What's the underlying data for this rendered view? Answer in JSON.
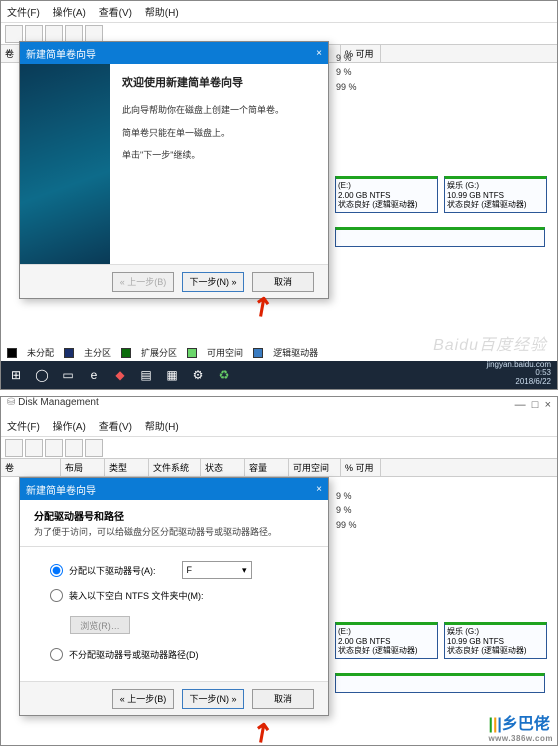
{
  "menu": {
    "file": "文件(F)",
    "action": "操作(A)",
    "view": "查看(V)",
    "help": "帮助(H)"
  },
  "app_title": "Disk Management",
  "win_ctrl": {
    "min": "—",
    "max": "□",
    "close": "×"
  },
  "columns": {
    "volume": "卷",
    "layout": "布局",
    "type": "类型",
    "fs": "文件系统",
    "status": "状态",
    "capacity": "容量",
    "free": "可用空间",
    "pct": "% 可用"
  },
  "pct_rows": [
    "9 %",
    "9 %",
    "99 %"
  ],
  "wizard_title": "新建简单卷向导",
  "step1": {
    "heading": "欢迎使用新建简单卷向导",
    "line1": "此向导帮助你在磁盘上创建一个简单卷。",
    "line2": "简单卷只能在单一磁盘上。",
    "line3": "单击\"下一步\"继续。"
  },
  "buttons": {
    "back": "« 上一步(B)",
    "next": "下一步(N) »",
    "cancel": "取消"
  },
  "step2": {
    "title": "分配驱动器号和路径",
    "sub": "为了便于访问，可以给磁盘分区分配驱动器号或驱动器路径。",
    "opt1": "分配以下驱动器号(A):",
    "opt2": "装入以下空白 NTFS 文件夹中(M):",
    "opt3": "不分配驱动器号或驱动器路径(D)",
    "drive": "F",
    "browse": "浏览(R)…"
  },
  "partitions": {
    "e": {
      "name": "(E:)",
      "size": "2.00 GB NTFS",
      "status": "状态良好 (逻辑驱动器)"
    },
    "g": {
      "name": "娱乐 (G:)",
      "size": "10.99 GB NTFS",
      "status": "状态良好 (逻辑驱动器)"
    }
  },
  "legend": {
    "unalloc": "未分配",
    "primary": "主分区",
    "extended": "扩展分区",
    "free": "可用空间",
    "logical": "逻辑驱动器"
  },
  "watermark": "Baidu百度经验",
  "clock": {
    "url": "jingyan.baidu.com",
    "time": "0:53",
    "date": "2018/6/22"
  },
  "logo": {
    "text": "乡巴佬",
    "url": "www.386w.com"
  },
  "taskbar_icons": [
    "⊞",
    "◯",
    "▭",
    "e",
    "◆",
    "▤",
    "▦",
    "⚙",
    "♻"
  ]
}
